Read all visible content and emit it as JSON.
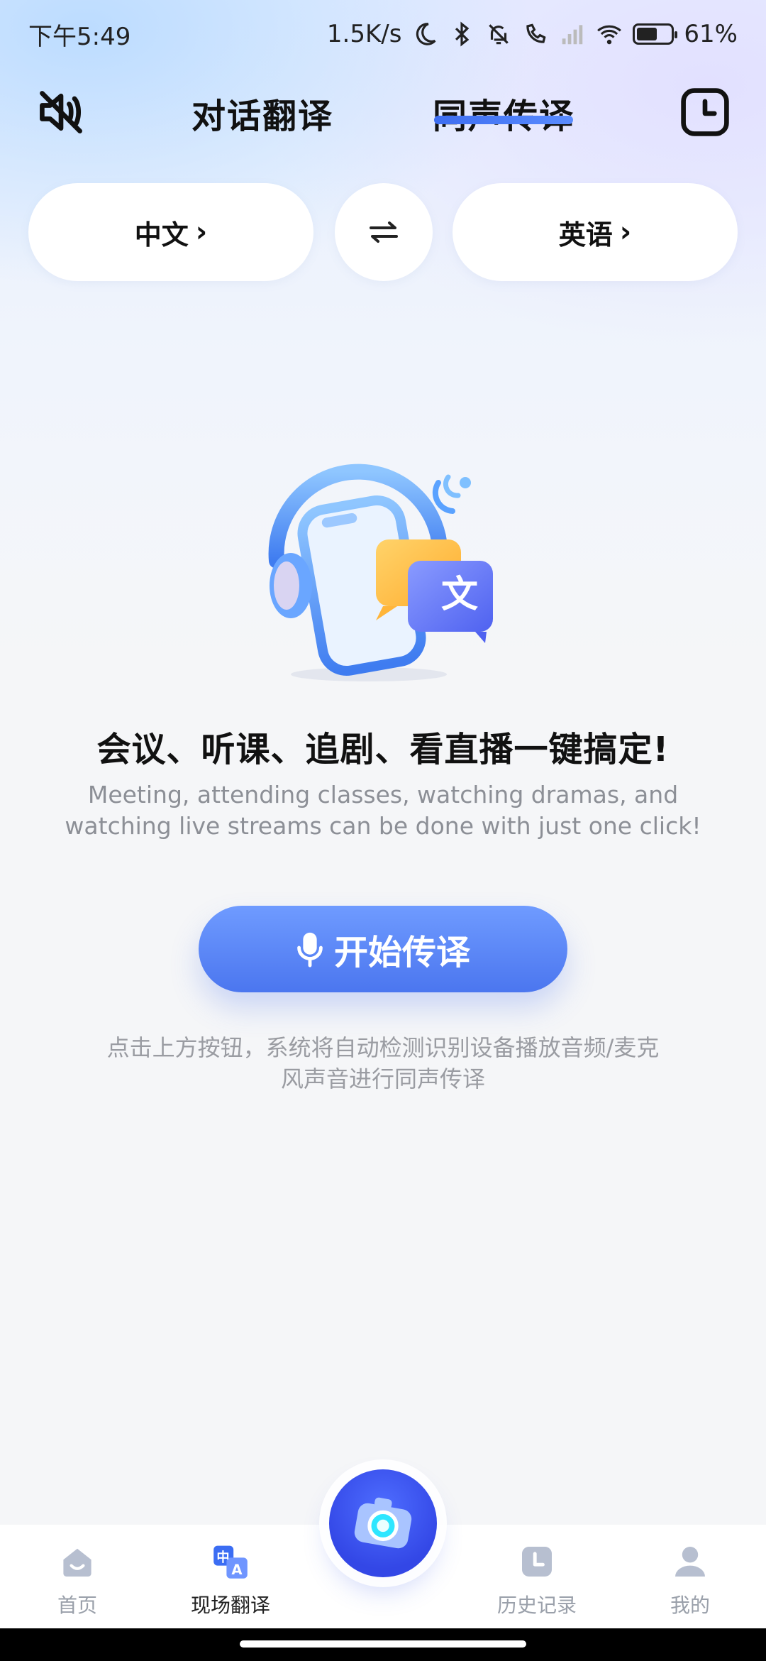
{
  "status_bar": {
    "time": "下午5:49",
    "net_speed": "1.5K/s",
    "battery": "61%",
    "battery_level": 0.61
  },
  "header": {
    "tab_dialog": "对话翻译",
    "tab_simultaneous": "同声传译",
    "active_tab": "同声传译"
  },
  "languages": {
    "source": "中文",
    "target": "英语"
  },
  "content": {
    "headline": "会议、听课、追剧、看直播一键搞定!",
    "subline": "Meeting, attending classes, watching dramas, and watching live streams can be done with just one click!",
    "start_button": "开始传译",
    "hint": "点击上方按钮，系统将自动检测识别设备播放音频/麦克风声音进行同声传译"
  },
  "nav": {
    "home": "首页",
    "live_translate": "现场翻译",
    "history": "历史记录",
    "me": "我的",
    "active": "现场翻译"
  },
  "colors": {
    "accent": "#4b76ef",
    "fab": "#3347e6"
  }
}
